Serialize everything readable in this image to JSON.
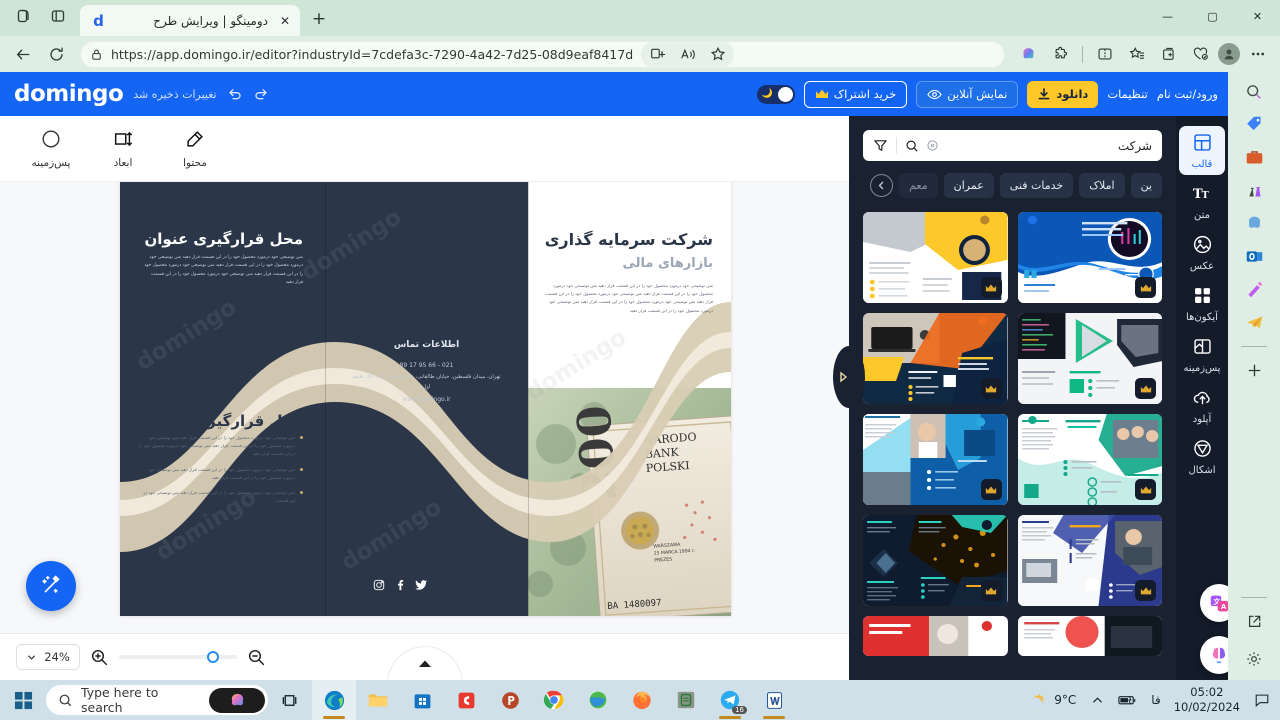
{
  "browser": {
    "tab": {
      "title": "دومینگو | ویرایش طرح",
      "favicon_letter": "d",
      "close_icon": "close-icon"
    },
    "new_tab_label": "+",
    "url": "https://app.domingo.ir/editor?industryId=7cdefa3c-7290-4a42-7d25-08d9eaf8417d",
    "window_buttons": {
      "minimize": "—",
      "maximize": "▢",
      "close": "✕"
    },
    "toolbar_icons": [
      "split-screen-icon",
      "read-aloud-icon",
      "favorite-star-icon",
      "copilot-icon",
      "extensions-icon",
      "browser-split-icon",
      "collections-icon",
      "add-collection-icon",
      "browser-essentials-icon",
      "profile-avatar",
      "settings-more-icon"
    ]
  },
  "app": {
    "logo": "domingo",
    "saved_status": "تغییرات ذخیره شد",
    "undo_icon": "undo-icon",
    "redo_icon": "redo-icon",
    "dark_mode_toggle": "dark-mode-toggle",
    "buttons": {
      "subscribe": "خرید اشتراک",
      "online_preview": "نمایش آنلاین",
      "download": "دانلود",
      "settings": "تنظیمات",
      "login": "ورود/ثبت نام"
    },
    "accent_blue": "#1565F5",
    "accent_yellow": "#FFC727"
  },
  "object_toolbar": [
    {
      "label": "پس‌زمینه",
      "icon": "circle-background-icon"
    },
    {
      "label": "ابعاد",
      "icon": "dimensions-icon"
    },
    {
      "label": "محتوا",
      "icon": "edit-content-icon"
    }
  ],
  "canvas": {
    "zoom_level": "24%",
    "magic_fab": "magic-wand-icon",
    "page_expand": "page-expand-icon",
    "document": {
      "panel_left": {
        "title": "محل قرارگیری عنوان",
        "body": "متن توضیحی خود درمورد محصول خود را در این قسمت قرار دهید متن توضیحی خود درمورد محصول خود را در این قسمت قرار دهید متن توضیحی خود درمورد محصول خود را در این قسمت قرار دهید متن توضیحی خود درمورد محصول خود را در این قسمت قرار دهید",
        "section2_title": "محل قرارگیری عنوان",
        "bullets": [
          "متن توضیحی خود درمورد محصول خود را در این قسمت قرار دهید متن توضیحی خود درمورد محصول خود را در این قسمت قرار دهید متن توضیحی خود درمورد محصول خود را در این قسمت قرار دهید",
          "متن توضیحی خود درمورد محصول خود را در این قسمت قرار دهید متن توضیحی خود درمورد محصول خود را در این قسمت قرار دهید",
          "متن توضیحی خود درمورد محصول خود را در این قسمت قرار دهید متن توضیحی خود در این قسمت"
        ]
      },
      "panel_middle": {
        "contact_title": "اطلاعات تماس",
        "phone": "021 - 66 95 17 89",
        "address": "تهران، میدان فلسطین، خیابان طالقانی، خیابان قدس، پلاک 30، طبقه اول",
        "website": "www.domingo.ir",
        "socials": [
          "instagram-icon",
          "facebook-icon",
          "twitter-icon"
        ]
      },
      "panel_right": {
        "title": "شرکت سرمایه گذاری",
        "subtitle": "بازارهای مالی",
        "body": "متن توضیحی خود درمورد محصول خود را در این قسمت قرار دهید متن توضیحی خود درمورد محصول خود را در این قسمت قرار دهید متن توضیحی خود درمورد محصول خود را در این قسمت قرار دهید متن توضیحی خود درمورد محصول خود را در این قسمت قرار دهید متن توضیحی خود درمورد محصول خود را در این قسمت قرار دهید"
      },
      "watermark": "domingo"
    }
  },
  "template_panel": {
    "filter_icon": "filter-icon",
    "search_icon": "search-icon",
    "clear_icon": "clear-search-icon",
    "search_value": "شرکت",
    "collapse_icon": "collapse-panel-icon",
    "chips_prev_icon": "chevron-left-icon",
    "chips": [
      "ین",
      "املاک",
      "خدمات فنی",
      "عمران",
      "معم"
    ],
    "crown_badge": "premium-crown-icon",
    "templates": [
      {
        "id": "tpl-1",
        "premium": true
      },
      {
        "id": "tpl-2",
        "premium": true
      },
      {
        "id": "tpl-3",
        "premium": true
      },
      {
        "id": "tpl-4",
        "premium": true
      },
      {
        "id": "tpl-5",
        "premium": true
      },
      {
        "id": "tpl-6",
        "premium": true
      },
      {
        "id": "tpl-7",
        "premium": true
      },
      {
        "id": "tpl-8",
        "premium": true
      },
      {
        "id": "tpl-9",
        "premium": false
      },
      {
        "id": "tpl-10",
        "premium": false
      }
    ]
  },
  "rail": [
    {
      "label": "قالب",
      "icon": "template-icon",
      "active": true
    },
    {
      "label": "متن",
      "icon": "text-icon",
      "active": false
    },
    {
      "label": "عکس",
      "icon": "image-icon",
      "active": false
    },
    {
      "label": "آیکون‌ها",
      "icon": "icons-grid-icon",
      "active": false
    },
    {
      "label": "پس‌زمینه",
      "icon": "background-icon",
      "active": false
    },
    {
      "label": "آپلود",
      "icon": "upload-cloud-icon",
      "active": false
    },
    {
      "label": "اشکال",
      "icon": "shapes-icon",
      "active": false
    }
  ],
  "taskbar": {
    "start_icon": "windows-start-icon",
    "search_placeholder": "Type here to search",
    "copilot_icon": "copilot-icon",
    "task_view_icon": "task-view-icon",
    "apps": [
      "edge-icon",
      "file-explorer-icon",
      "microsoft-store-icon",
      "camtasia-icon",
      "powerpoint-icon",
      "chrome-icon",
      "internet-icon",
      "firefox-icon",
      "notes-icon",
      "telegram-icon",
      "word-icon"
    ],
    "telegram_badge": "16",
    "weather_temp": "9°C",
    "weather_icon": "partly-cloudy-icon",
    "tray_chevron": "chevron-up-icon",
    "battery_icon": "battery-icon",
    "language": "فا",
    "time": "05:02",
    "date": "10/02/2024",
    "notification_icon": "notification-icon"
  }
}
